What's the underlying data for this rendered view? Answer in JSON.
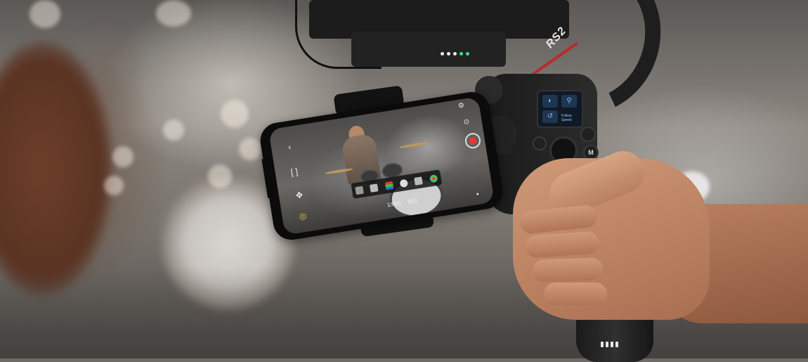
{
  "gimbal": {
    "model_label": "RS2",
    "handle_screen_text": "Follow Speed",
    "button_m_label": "M"
  },
  "phone_app": {
    "status_left": "1/800",
    "status_right": "800"
  }
}
